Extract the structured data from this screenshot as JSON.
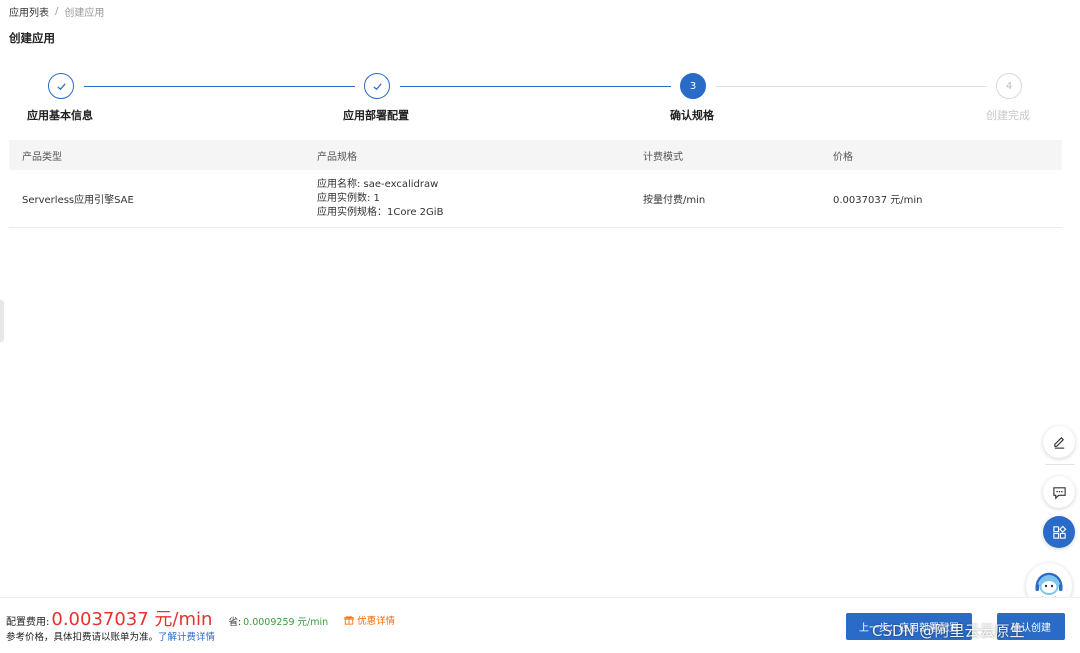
{
  "breadcrumb": {
    "items": [
      "应用列表",
      "创建应用"
    ],
    "separator": "/"
  },
  "page_title": "创建应用",
  "steps": [
    {
      "number": "1",
      "label": "应用基本信息",
      "status": "done"
    },
    {
      "number": "2",
      "label": "应用部署配置",
      "status": "done"
    },
    {
      "number": "3",
      "label": "确认规格",
      "status": "active"
    },
    {
      "number": "4",
      "label": "创建完成",
      "status": "todo"
    }
  ],
  "table": {
    "headers": [
      "产品类型",
      "产品规格",
      "计费模式",
      "价格"
    ],
    "row": {
      "product_type": "Serverless应用引擎SAE",
      "spec": [
        "应用名称: sae-excalidraw",
        "应用实例数: 1",
        "应用实例规格：1Core 2GiB"
      ],
      "billing": "按量付费/min",
      "price": "0.0037037 元/min"
    }
  },
  "footer": {
    "fee_label": "配置费用:",
    "fee_value": "0.0037037 元/min",
    "save_label": "省:",
    "save_value": "0.0009259 元/min",
    "discount_label": "优惠详情",
    "ref_text": "参考价格，具体扣费请以账单为准。",
    "ref_link": "了解计费详情",
    "prev_button": "上一步：应用部署配置",
    "confirm_button": "确认创建"
  },
  "watermark": "CSDN @阿里云云原生",
  "colors": {
    "primary": "#2a6bc8",
    "price_red": "#e6312e",
    "save_green": "#3a9b3a",
    "discount_orange": "#ff6a00"
  },
  "icons": [
    "check-icon",
    "edit-icon",
    "feedback-icon",
    "apps-icon",
    "assistant-icon",
    "gift-icon"
  ]
}
